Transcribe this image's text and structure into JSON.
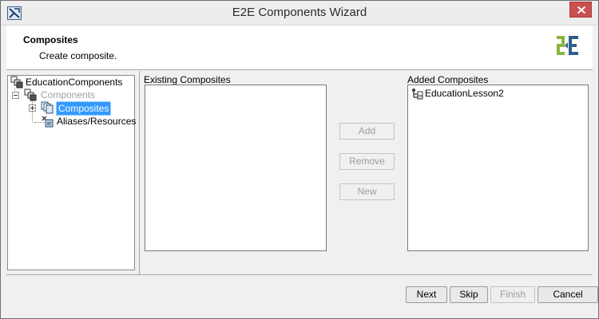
{
  "window": {
    "title": "E2E Components Wizard",
    "app_icon": "wizard-app-icon",
    "close_icon": "close-icon"
  },
  "header": {
    "title": "Composites",
    "subtitle": "Create composite.",
    "logo_icon": "e2e-logo-icon"
  },
  "tree": {
    "items": [
      {
        "label": "EducationComponents",
        "icon": "components-root-icon"
      },
      {
        "label": "Components",
        "icon": "components-icon",
        "state": "disabled",
        "expander": "minus"
      },
      {
        "label": "Composites",
        "icon": "composites-icon",
        "state": "selected",
        "expander": "plus"
      },
      {
        "label": "Aliases/Resources",
        "icon": "aliases-resources-icon"
      }
    ]
  },
  "existing": {
    "label": "Existing Composites",
    "items": []
  },
  "added": {
    "label": "Added Composites",
    "items": [
      {
        "label": "EducationLesson2",
        "icon": "composite-item-icon"
      }
    ]
  },
  "actions": {
    "add": "Add",
    "remove": "Remove",
    "new": "New"
  },
  "footer": {
    "next": "Next",
    "skip": "Skip",
    "finish": "Finish",
    "cancel": "Cancel"
  },
  "colors": {
    "selection": "#3399ff",
    "close_button": "#c75050",
    "logo_green": "#8cb43c",
    "logo_blue": "#2e5f8a"
  }
}
